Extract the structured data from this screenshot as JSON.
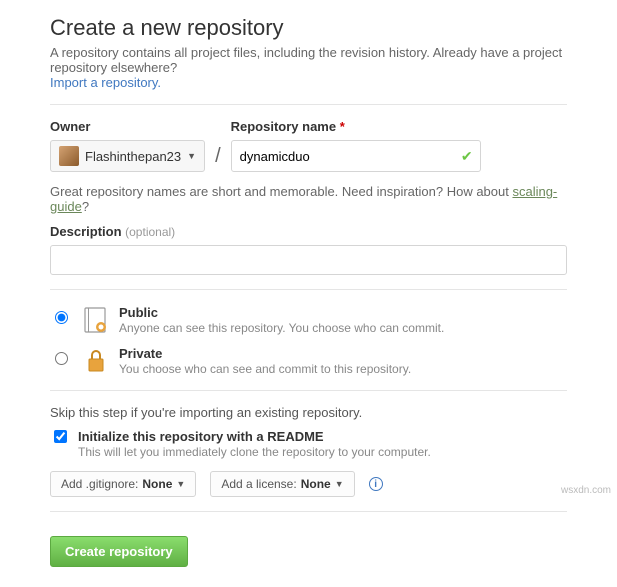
{
  "header": {
    "title": "Create a new repository",
    "subtitle_a": "A repository contains all project files, including the revision history. Already have a project repository elsewhere?",
    "import_link": "Import a repository."
  },
  "owner": {
    "label": "Owner",
    "username": "Flashinthepan23"
  },
  "repo": {
    "label": "Repository name",
    "value": "dynamicduo"
  },
  "hint": {
    "text_a": "Great repository names are short and memorable. Need inspiration? How about ",
    "suggestion": "scaling-guide",
    "text_b": "?"
  },
  "description": {
    "label": "Description",
    "optional": "(optional)",
    "value": ""
  },
  "visibility": {
    "public": {
      "title": "Public",
      "desc": "Anyone can see this repository. You choose who can commit."
    },
    "private": {
      "title": "Private",
      "desc": "You choose who can see and commit to this repository."
    }
  },
  "init": {
    "skip_text": "Skip this step if you're importing an existing repository.",
    "readme_label": "Initialize this repository with a README",
    "readme_desc": "This will let you immediately clone the repository to your computer."
  },
  "dropdowns": {
    "gitignore_prefix": "Add .gitignore: ",
    "gitignore_value": "None",
    "license_prefix": "Add a license: ",
    "license_value": "None",
    "info_char": "i"
  },
  "submit": {
    "label": "Create repository"
  },
  "watermark": "wsxdn.com"
}
